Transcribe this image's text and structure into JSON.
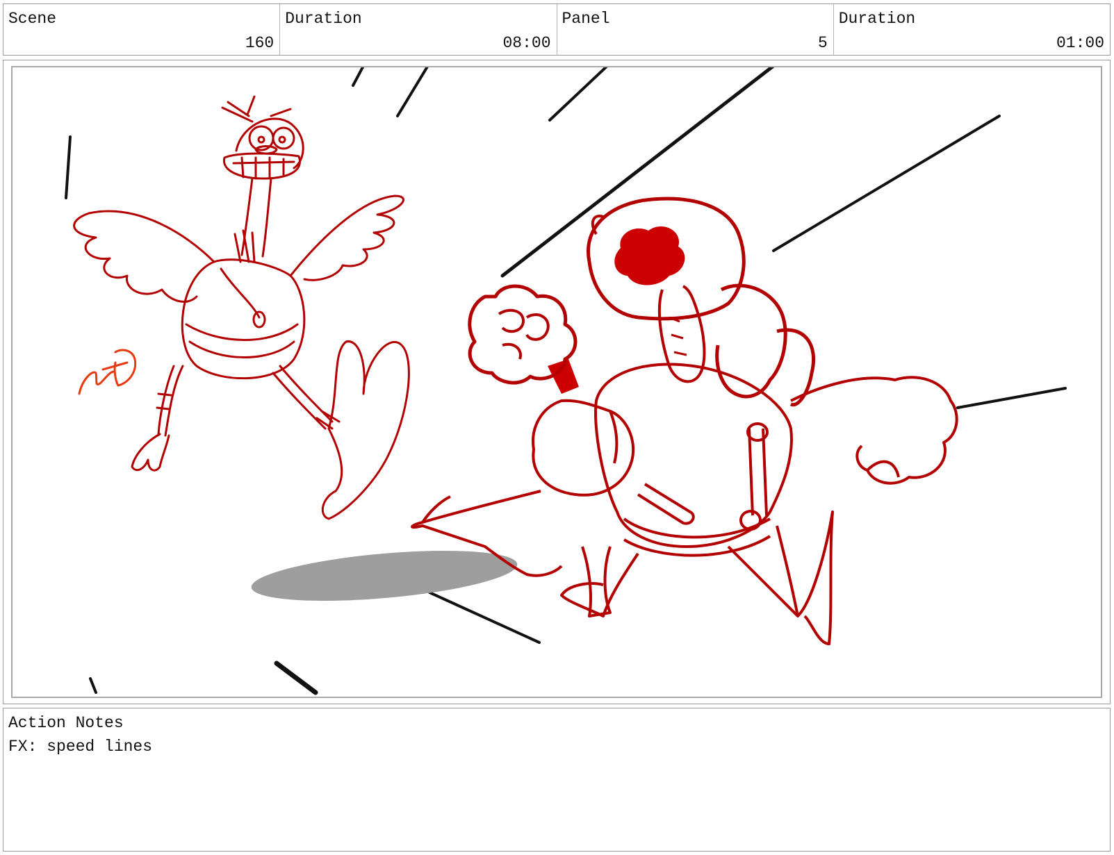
{
  "header": {
    "scene_label": "Scene",
    "scene_value": "160",
    "scene_duration_label": "Duration",
    "scene_duration_value": "08:00",
    "panel_label": "Panel",
    "panel_value": "5",
    "panel_duration_label": "Duration",
    "panel_duration_value": "01:00"
  },
  "frame": {
    "line_color": "#b30000",
    "fill_color": "#cc0000",
    "speed_line_color": "#111111",
    "shadow_color": "#9e9e9e",
    "mark_color": "#e83a10"
  },
  "notes": {
    "title": "Action Notes",
    "body": "FX: speed lines"
  }
}
